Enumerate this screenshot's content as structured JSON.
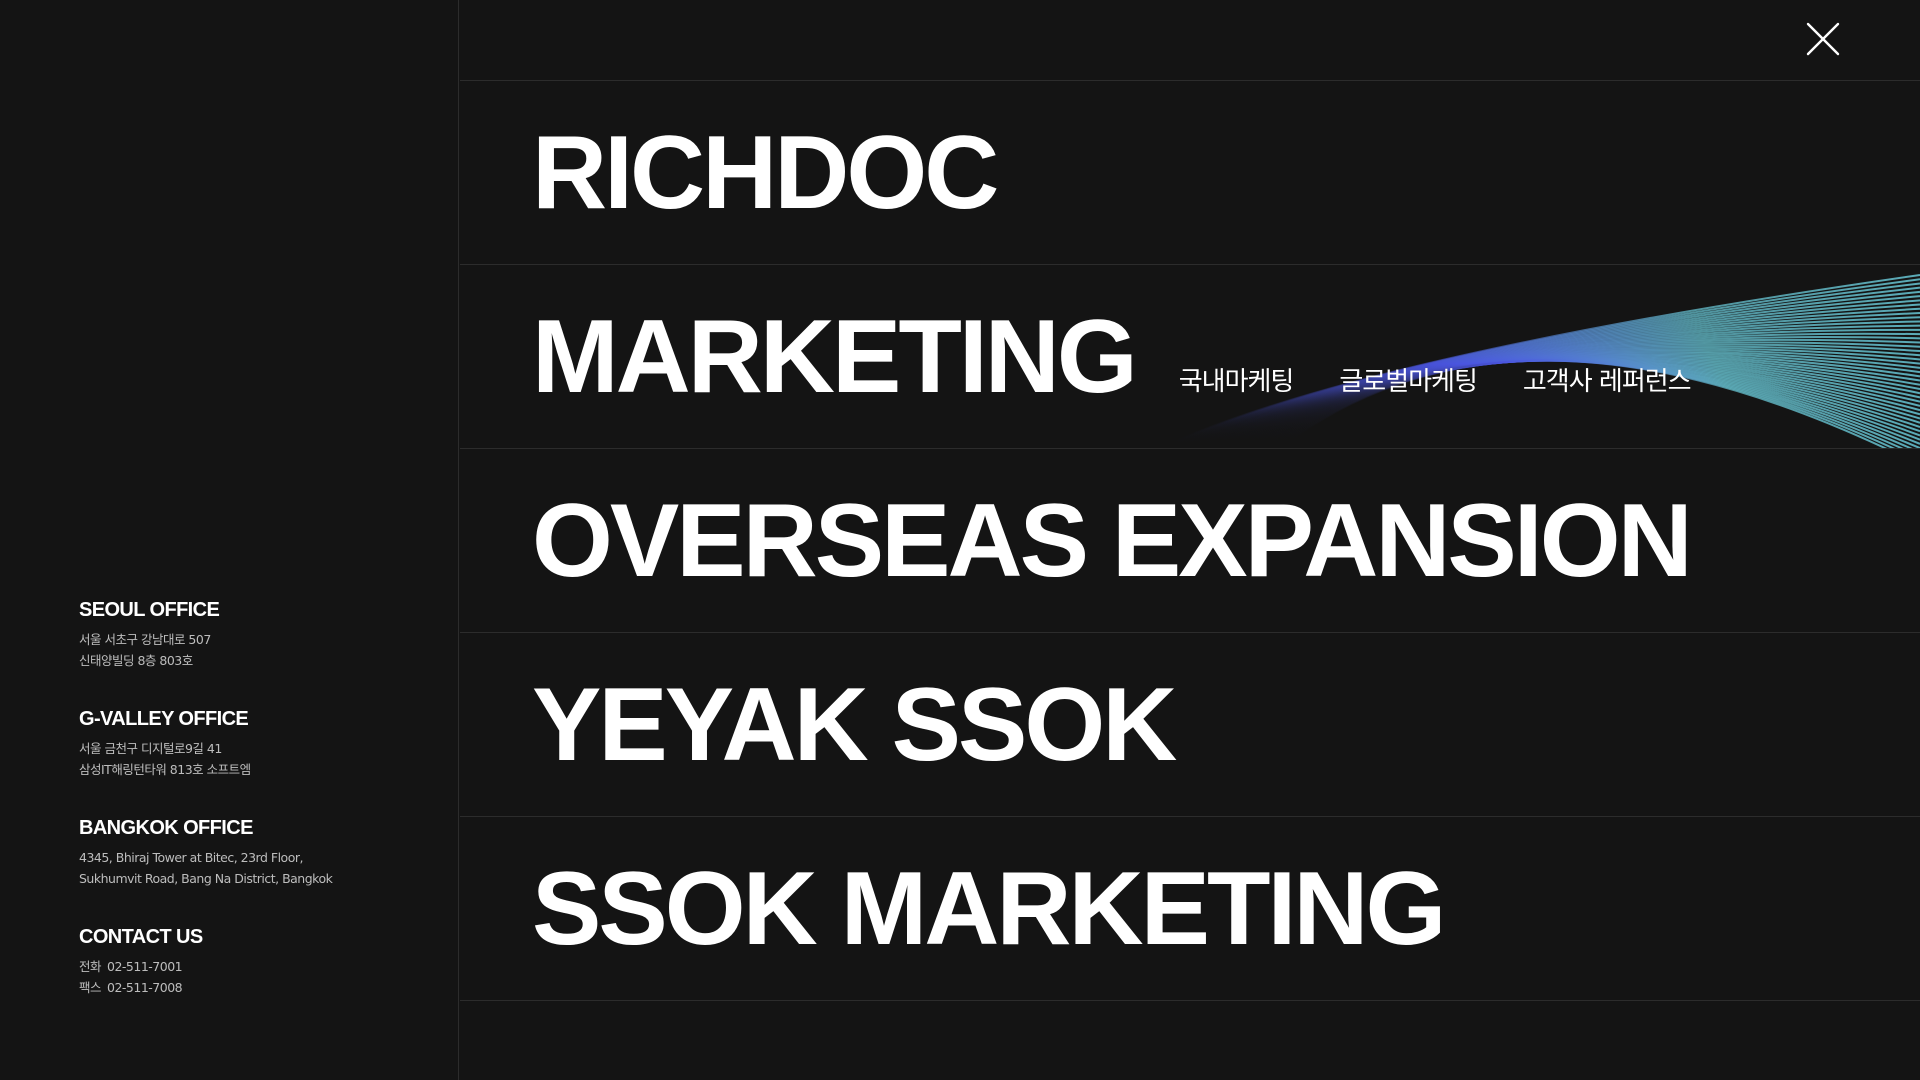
{
  "offices": [
    {
      "title": "SEOUL OFFICE",
      "lines": [
        "서울 서초구 강남대로 507",
        "신태양빌딩 8층 803호"
      ]
    },
    {
      "title": "G-VALLEY OFFICE",
      "lines": [
        "서울 금천구 디지털로9길 41",
        "삼성IT해링턴타워 813호 소프트엠"
      ]
    },
    {
      "title": "BANGKOK OFFICE",
      "lines": [
        "4345, Bhiraj Tower at Bitec, 23rd Floor,",
        "Sukhumvit Road, Bang Na District, Bangkok"
      ]
    }
  ],
  "contact": {
    "title": "CONTACT US",
    "phone_label": "전화",
    "phone": "02-511-7001",
    "fax_label": "팩스",
    "fax": "02-511-7008"
  },
  "close_icon": "close-icon",
  "menu": {
    "items": [
      {
        "label": "RICHDOC"
      },
      {
        "label": "MARKETING",
        "submenu": [
          "국내마케팅",
          "글로벌마케팅",
          "고객사 레퍼런스"
        ]
      },
      {
        "label": "OVERSEAS EXPANSION"
      },
      {
        "label": "YEYAK SSOK"
      },
      {
        "label": "SSOK MARKETING"
      }
    ]
  },
  "colors": {
    "background": "#141414",
    "divider": "#2c2c2c",
    "text": "#ffffff",
    "muted_text": "#bdbdbd",
    "accent_blue": "#4a55e0",
    "accent_teal": "#5fb3c0"
  }
}
